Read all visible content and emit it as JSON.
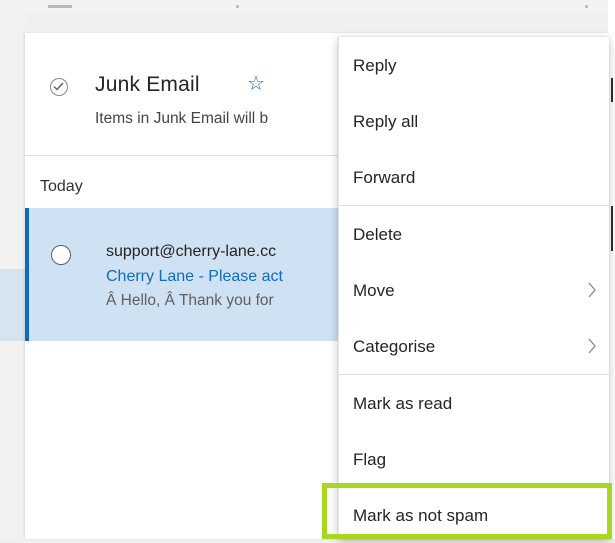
{
  "header": {
    "folder_title": "Junk Email",
    "star_icon": "☆",
    "note": "Items in Junk Email will b"
  },
  "list": {
    "group_label": "Today",
    "email": {
      "sender": "support@cherry-lane.cc",
      "subject": "Cherry Lane - Please act",
      "preview": "Â Hello, Â Thank you for"
    }
  },
  "context_menu": {
    "items": [
      {
        "label": "Reply"
      },
      {
        "label": "Reply all"
      },
      {
        "label": "Forward"
      },
      {
        "label": "Delete"
      },
      {
        "label": "Move",
        "submenu": true
      },
      {
        "label": "Categorise",
        "submenu": true
      },
      {
        "label": "Mark as read"
      },
      {
        "label": "Flag"
      },
      {
        "label": "Mark as not spam",
        "highlighted": true
      }
    ]
  },
  "colors": {
    "accent": "#0f6cbd",
    "selected_row": "#cfe2f3",
    "highlight_box": "#a8d722"
  },
  "icons": {
    "header_check": "check-circle-icon",
    "star": "star-outline-icon",
    "chevron": "chevron-right-icon"
  }
}
